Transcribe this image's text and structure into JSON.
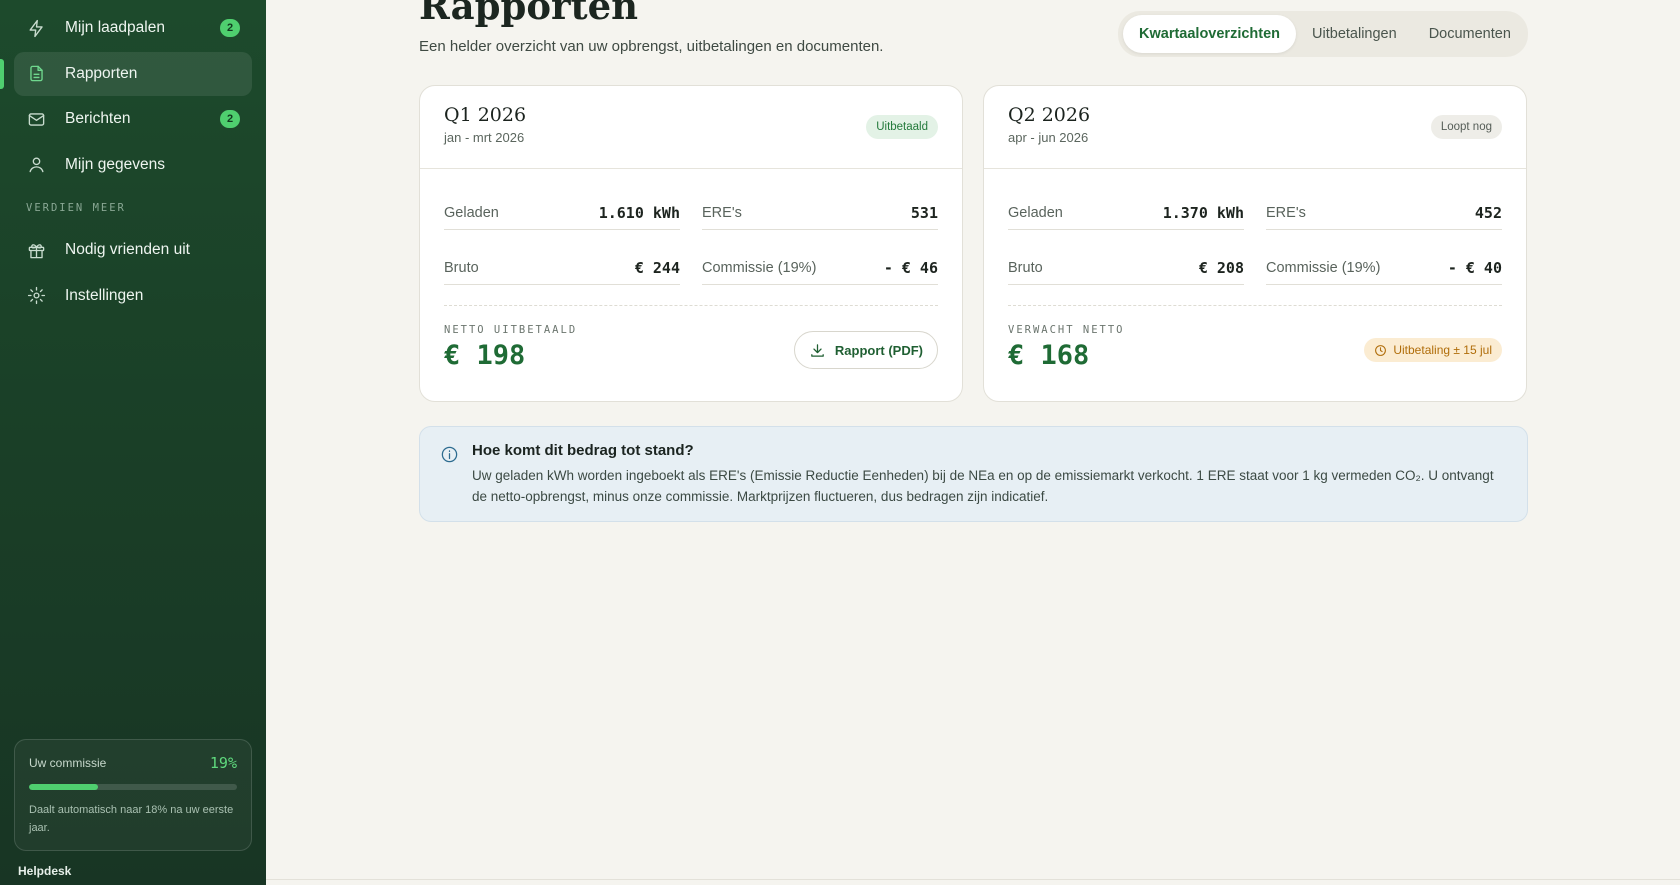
{
  "sidebar": {
    "items": [
      {
        "label": "Mijn laadpalen",
        "icon": "bolt-icon",
        "badge": "2"
      },
      {
        "label": "Rapporten",
        "icon": "document-icon",
        "active": true
      },
      {
        "label": "Berichten",
        "icon": "mail-icon",
        "badge": "2"
      },
      {
        "label": "Mijn gegevens",
        "icon": "user-icon"
      }
    ],
    "section_label": "VERDIEN MEER",
    "extra_items": [
      {
        "label": "Nodig vrienden uit",
        "icon": "gift-icon"
      },
      {
        "label": "Instellingen",
        "icon": "gear-icon"
      }
    ],
    "commission": {
      "label": "Uw commissie",
      "value": "19%",
      "progress": 0.33,
      "note": "Daalt automatisch naar 18% na uw eerste jaar."
    },
    "helpdesk": "Helpdesk"
  },
  "header": {
    "title": "Rapporten",
    "subtitle": "Een helder overzicht van uw opbrengst, uitbetalingen en documenten.",
    "tabs": [
      "Kwartaaloverzichten",
      "Uitbetalingen",
      "Documenten"
    ]
  },
  "cards": [
    {
      "quarter": "Q1 2026",
      "range": "jan - mrt 2026",
      "status": "Uitbetaald",
      "charged_label": "Geladen",
      "charged": "1.610 kWh",
      "ere_label": "ERE's",
      "ere": "531",
      "gross_label": "Bruto",
      "gross": "€ 244",
      "commission_label": "Commissie (19%)",
      "commission": "- € 46",
      "net_label": "NETTO UITBETAALD",
      "net": "€ 198",
      "action": "Rapport (PDF)"
    },
    {
      "quarter": "Q2 2026",
      "range": "apr - jun 2026",
      "status": "Loopt nog",
      "charged_label": "Geladen",
      "charged": "1.370 kWh",
      "ere_label": "ERE's",
      "ere": "452",
      "gross_label": "Bruto",
      "gross": "€ 208",
      "commission_label": "Commissie (19%)",
      "commission": "- € 40",
      "net_label": "VERWACHT NETTO",
      "net": "€ 168",
      "payout": "Uitbetaling ± 15 jul"
    }
  ],
  "info": {
    "title": "Hoe komt dit bedrag tot stand?",
    "text": "Uw geladen kWh worden ingeboekt als ERE's (Emissie Reductie Eenheden) bij de NEa en op de emissiemarkt verkocht. 1 ERE staat voor 1 kg vermeden CO₂. U ontvangt de netto-opbrengst, minus onze commissie. Marktprijzen fluctueren, dus bedragen zijn indicatief."
  },
  "colors": {
    "accent": "#1f6b35",
    "sidebar": "#1d4a2c",
    "badge": "#4fcf6f"
  }
}
